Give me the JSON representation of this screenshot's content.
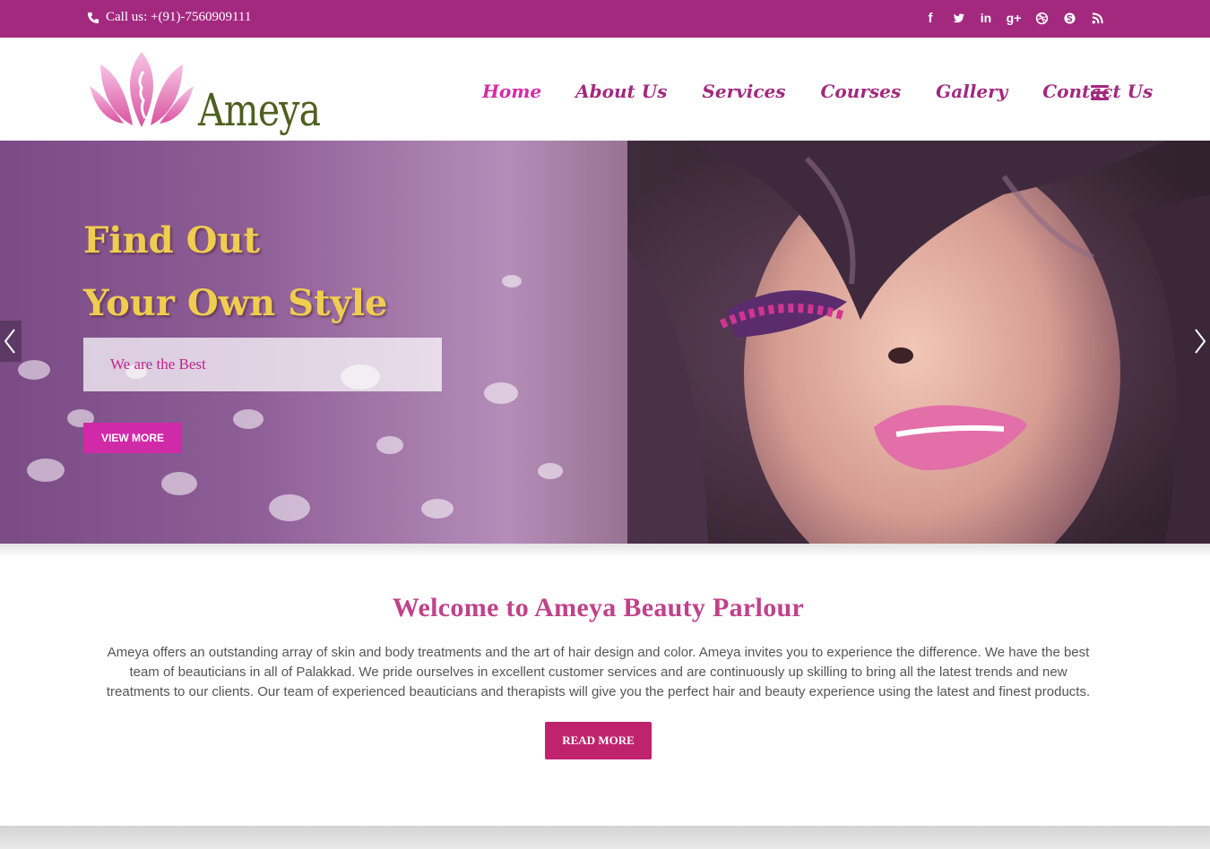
{
  "topbar": {
    "phone_text": "Call us: +(91)-7560909111",
    "socials": [
      {
        "icon": "facebook-icon",
        "glyph": "f"
      },
      {
        "icon": "twitter-icon",
        "glyph": ""
      },
      {
        "icon": "linkedin-icon",
        "glyph": "in"
      },
      {
        "icon": "google-plus-icon",
        "glyph": "g+"
      },
      {
        "icon": "dribbble-icon",
        "glyph": ""
      },
      {
        "icon": "skype-icon",
        "glyph": ""
      },
      {
        "icon": "rss-icon",
        "glyph": ""
      }
    ]
  },
  "header": {
    "logo_text": "Ameya",
    "nav": [
      "Home",
      "About Us",
      "Services",
      "Courses",
      "Gallery",
      "Contact Us"
    ],
    "active_nav": "Home"
  },
  "hero": {
    "heading_line1": "Find Out",
    "heading_line2": "Your Own Style",
    "tagline": "We are the Best",
    "button": "VIEW MORE"
  },
  "welcome": {
    "title": "Welcome to Ameya Beauty Parlour",
    "text": "Ameya offers an outstanding array of skin and body treatments and the art of hair design and color. Ameya invites you to experience the difference. We have the best team of beauticians in all of Palakkad. We pride ourselves in excellent customer services and are continuously up skilling to bring all the latest trends and new treatments to our clients. Our team of experienced beauticians and therapists will give you the perfect hair and beauty experience using the latest and finest products.",
    "button": "READ MORE"
  },
  "colors": {
    "brand_purple": "#a3297f",
    "accent_pink": "#d02aa8",
    "title_pink": "#c0428a",
    "gold": "#f0cd4f",
    "logo_green": "#4e5f1e"
  }
}
